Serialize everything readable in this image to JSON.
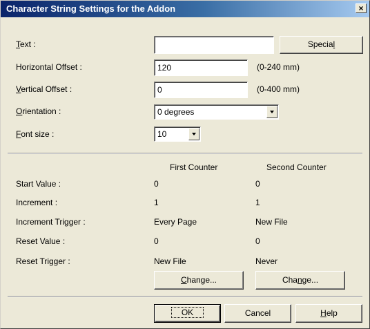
{
  "title": "Character String Settings for the Addon",
  "close_label": "×",
  "text": {
    "label_u": "T",
    "label_rest": "ext :",
    "value": "",
    "special_pre": "Specia",
    "special_u": "l"
  },
  "horizontal": {
    "label": "Horizontal Offset :",
    "value": "120",
    "range": "(0-240 mm)"
  },
  "vertical": {
    "label_u": "V",
    "label_rest": "ertical Offset :",
    "value": "0",
    "range": "(0-400 mm)"
  },
  "orientation": {
    "label_u": "O",
    "label_rest": "rientation :",
    "value": "0 degrees"
  },
  "fontsize": {
    "label_u": "F",
    "label_rest": "ont size :",
    "value": "10"
  },
  "counters": {
    "first_header": "First Counter",
    "second_header": "Second Counter",
    "rows": [
      {
        "label": "Start Value :",
        "first": "0",
        "second": "0"
      },
      {
        "label": "Increment :",
        "first": "1",
        "second": "1"
      },
      {
        "label": "Increment Trigger :",
        "first": "Every Page",
        "second": "New File"
      },
      {
        "label": "Reset Value :",
        "first": "0",
        "second": "0"
      },
      {
        "label": "Reset Trigger :",
        "first": "New File",
        "second": "Never"
      }
    ],
    "change1_u": "C",
    "change1_rest": "hange...",
    "change2_pre": "Cha",
    "change2_u": "n",
    "change2_rest": "ge..."
  },
  "buttons": {
    "ok": "OK",
    "cancel": "Cancel",
    "help_u": "H",
    "help_rest": "elp"
  }
}
